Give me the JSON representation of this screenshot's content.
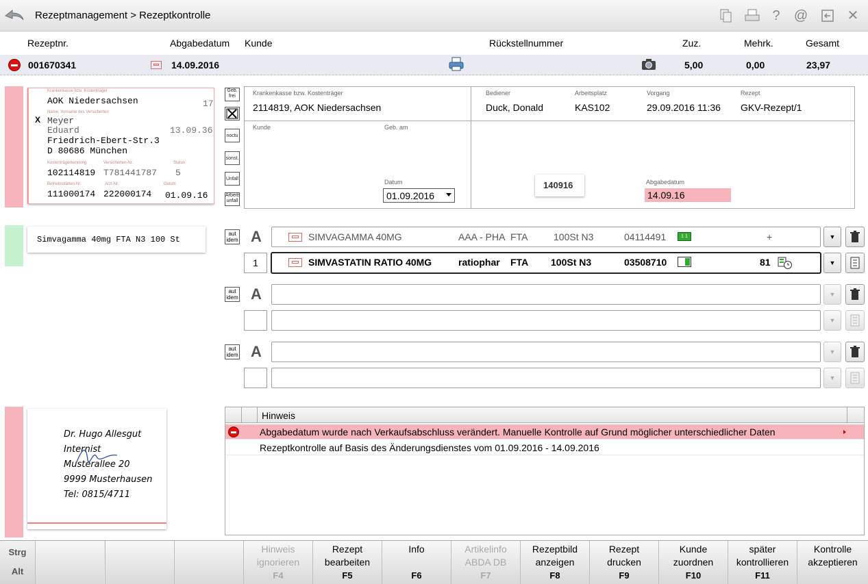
{
  "title": {
    "breadcrumb": "Rezeptmanagement > Rezeptkontrolle"
  },
  "toolbar_icons": [
    "copy-icon",
    "print-icon",
    "help-icon",
    "email-icon",
    "exit-window-icon",
    "close-icon"
  ],
  "toolbar_glyphs": {
    "help": "?",
    "email": "@",
    "close": "✕"
  },
  "columns": {
    "rezeptnr": "Rezeptnr.",
    "abgabedatum": "Abgabedatum",
    "kunde": "Kunde",
    "rueckstell": "Rückstellnummer",
    "zuz": "Zuz.",
    "mehrk": "Mehrk.",
    "gesamt": "Gesamt"
  },
  "rx": {
    "nr": "001670341",
    "datum": "14.09.2016",
    "zuz": "5,00",
    "mehrk": "0,00",
    "gesamt": "23,97"
  },
  "scan_form": {
    "hdr": "Krankenkasse bzw. Kostenträger",
    "kasse": "AOK Niedersachsen",
    "num17": "17",
    "x": "X",
    "name": "Meyer",
    "vorname": "Eduard",
    "date1": "13.09.36",
    "street": "Friedrich-Ebert-Str.3",
    "city": "D 80686  München",
    "kostentr": "102114819",
    "versnr": "T781441787",
    "status": "5",
    "bsnr": "111000174",
    "arztnr": "222000174",
    "date2": "01.09.16",
    "lbl_name": "Name, Vorname des Versicherten",
    "lbl_kt": "Kostenträgerkennung",
    "lbl_vn": "Versicherten-Nr.",
    "lbl_st": "Status",
    "lbl_bs": "Betriebsstätten-Nr.",
    "lbl_ar": "Arzt-Nr.",
    "lbl_dt": "Datum"
  },
  "side_buttons": [
    "Geb. frei",
    "",
    "noctu",
    "sonst.",
    "Unfall",
    "Arbeits- unfall"
  ],
  "info": {
    "kk_lbl": "Krankenkasse bzw. Kostenträger",
    "kk_val": "2114819, AOK Niedersachsen",
    "bed_lbl": "Bediener",
    "bed_val": "Duck, Donald",
    "ap_lbl": "Arbeitsplatz",
    "ap_val": "KAS102",
    "vg_lbl": "Vorgang",
    "vg_val": "29.09.2016 11:36",
    "rz_lbl": "Rezept",
    "rz_val": "GKV-Rezept/1",
    "kd_lbl": "Kunde",
    "geb_lbl": "Geb. am",
    "dat_lbl": "Datum",
    "dat_val": "01.09.2016",
    "stamp": "140916",
    "abg_lbl": "Abgabedatum",
    "abg_val": "14.09.16"
  },
  "scan_article": "Simvagamma 40mg FTA N3 100 St",
  "articles": [
    {
      "autidem": "aut idem",
      "A": "A",
      "name": "SIMVAGAMMA 40MG",
      "hersteller": "AAA - PHA",
      "form": "FTA",
      "pack": "100St N3",
      "pzn": "04114491",
      "extra": "+"
    },
    {
      "qty": "1",
      "name": "SIMVASTATIN RATIO 40MG",
      "hersteller": "ratiophar",
      "form": "FTA",
      "pack": "100St N3",
      "pzn": "03508710",
      "extra": "81"
    }
  ],
  "empty_autidem": "aut idem",
  "empty_A": "A",
  "doctor": {
    "l1": "Dr. Hugo Allesgut",
    "l2": "Internist",
    "l3": "Musterallee 20",
    "l4": "9999 Musterhausen",
    "l5": "Tel: 0815/4711"
  },
  "hints": {
    "header": "Hinweis",
    "rows": [
      "Abgabedatum wurde nach Verkaufsabschluss verändert. Manuelle Kontrolle auf Grund möglicher unterschiedlicher Daten",
      "Rezeptkontrolle auf Basis des Änderungsdienstes vom 01.09.2016 - 14.09.2016"
    ]
  },
  "modkeys": {
    "strg": "Strg",
    "alt": "Alt"
  },
  "fkeys": [
    {
      "l1": "Hinweis",
      "l2": "ignorieren",
      "k": "F4",
      "disabled": true
    },
    {
      "l1": "Rezept",
      "l2": "bearbeiten",
      "k": "F5",
      "disabled": false
    },
    {
      "l1": "Info",
      "l2": "",
      "k": "F6",
      "disabled": false
    },
    {
      "l1": "Artikelinfo",
      "l2": "ABDA DB",
      "k": "F7",
      "disabled": true
    },
    {
      "l1": "Rezeptbild",
      "l2": "anzeigen",
      "k": "F8",
      "disabled": false
    },
    {
      "l1": "Rezept",
      "l2": "drucken",
      "k": "F9",
      "disabled": false
    },
    {
      "l1": "Kunde",
      "l2": "zuordnen",
      "k": "F10",
      "disabled": false
    },
    {
      "l1": "später",
      "l2": "kontrollieren",
      "k": "F11",
      "disabled": false
    },
    {
      "l1": "Kontrolle",
      "l2": "akzeptieren",
      "k": "",
      "disabled": false
    }
  ],
  "colors": {
    "red": "#f7b5bb",
    "green": "#c6f2cf",
    "selected_row": "#f7b5bb"
  }
}
